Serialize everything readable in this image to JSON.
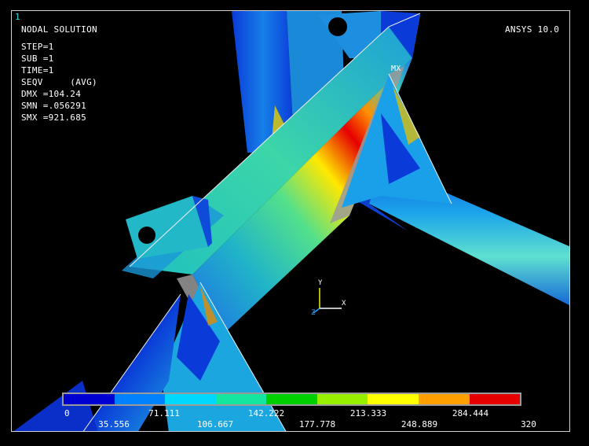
{
  "window_number": "1",
  "product": "ANSYS 10.0",
  "result": {
    "title": "NODAL SOLUTION",
    "lines": [
      "STEP=1",
      "SUB =1",
      "TIME=1",
      "SEQV     (AVG)",
      "DMX =104.24",
      "SMN =.056291",
      "SMX =921.685"
    ]
  },
  "max_marker": "MX",
  "triad": {
    "y": "Y",
    "x": "X",
    "z": "Z"
  },
  "legend": {
    "colors": [
      "#0000d2",
      "#0082ff",
      "#00d8ff",
      "#14e6a0",
      "#00d000",
      "#96f000",
      "#ffff00",
      "#ffa000",
      "#e60000"
    ],
    "top_labels": [
      "0",
      "71.111",
      "142.222",
      "213.333",
      "284.444"
    ],
    "bottom_labels": [
      "35.556",
      "106.667",
      "177.778",
      "248.889",
      "320"
    ]
  }
}
